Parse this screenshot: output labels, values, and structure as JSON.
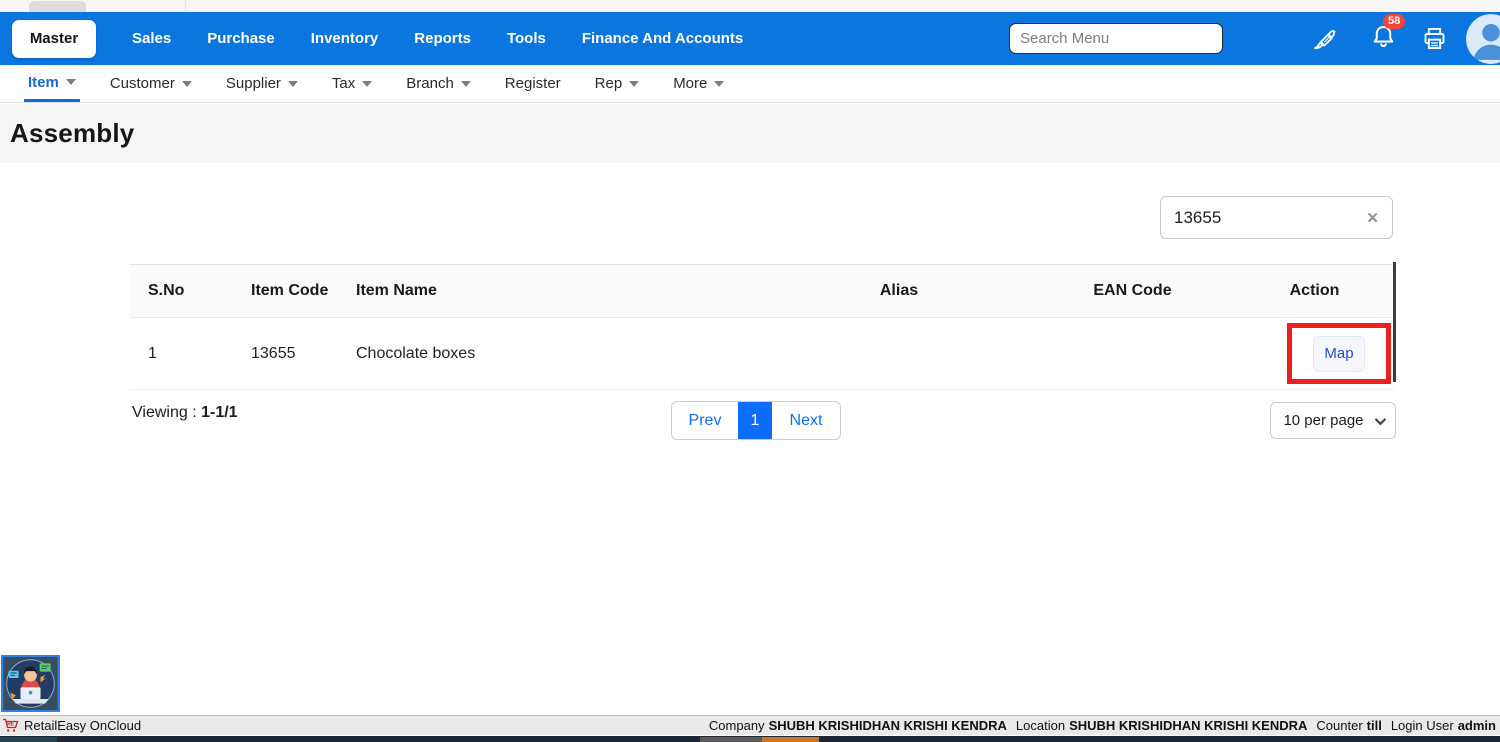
{
  "topbar": {
    "tabs": [
      {
        "label": "Master",
        "active": true
      },
      {
        "label": "Sales"
      },
      {
        "label": "Purchase"
      },
      {
        "label": "Inventory"
      },
      {
        "label": "Reports"
      },
      {
        "label": "Tools"
      },
      {
        "label": "Finance And Accounts"
      }
    ],
    "search": {
      "placeholder": "Search Menu"
    },
    "notifications": {
      "count": "58"
    }
  },
  "subnav": {
    "items": [
      {
        "label": "Item",
        "active": true,
        "dropdown": true
      },
      {
        "label": "Customer",
        "dropdown": true
      },
      {
        "label": "Supplier",
        "dropdown": true
      },
      {
        "label": "Tax",
        "dropdown": true
      },
      {
        "label": "Branch",
        "dropdown": true
      },
      {
        "label": "Register",
        "dropdown": false
      },
      {
        "label": "Rep",
        "dropdown": true
      },
      {
        "label": "More",
        "dropdown": true
      }
    ]
  },
  "page": {
    "title": "Assembly"
  },
  "filter": {
    "value": "13655",
    "clear_icon": "✕"
  },
  "table": {
    "headers": [
      "S.No",
      "Item Code",
      "Item Name",
      "Alias",
      "EAN Code",
      "Action"
    ],
    "rows": [
      {
        "sno": "1",
        "item_code": "13655",
        "item_name": "Chocolate boxes",
        "alias": "",
        "ean_code": "",
        "action_label": "Map"
      }
    ]
  },
  "pagination": {
    "viewing_label": "Viewing :",
    "viewing_value": "1-1/1",
    "prev_label": "Prev",
    "current_page": "1",
    "next_label": "Next",
    "per_page_label": "10 per page"
  },
  "statusbar": {
    "app_name": "RetailEasy OnCloud",
    "company_label": "Company",
    "company_value": "SHUBH KRISHIDHAN KRISHI KENDRA",
    "location_label": "Location",
    "location_value": "SHUBH KRISHIDHAN KRISHI KENDRA",
    "counter_label": "Counter",
    "counter_value": "till",
    "login_label": "Login User",
    "login_value": "admin"
  },
  "colors": {
    "topbar_blue": "#0b76e0",
    "accent_blue": "#0d6efd",
    "highlight_red": "#e9211d",
    "badge_red": "#f9423a",
    "active_subnav_blue": "#1569d6"
  },
  "icons": {
    "brush": "paint-brush-icon",
    "bell": "notification-bell-icon",
    "printer": "printer-icon",
    "avatar": "user-avatar",
    "cart": "retaileasy-cart-logo",
    "chat": "support-chat-avatar"
  }
}
